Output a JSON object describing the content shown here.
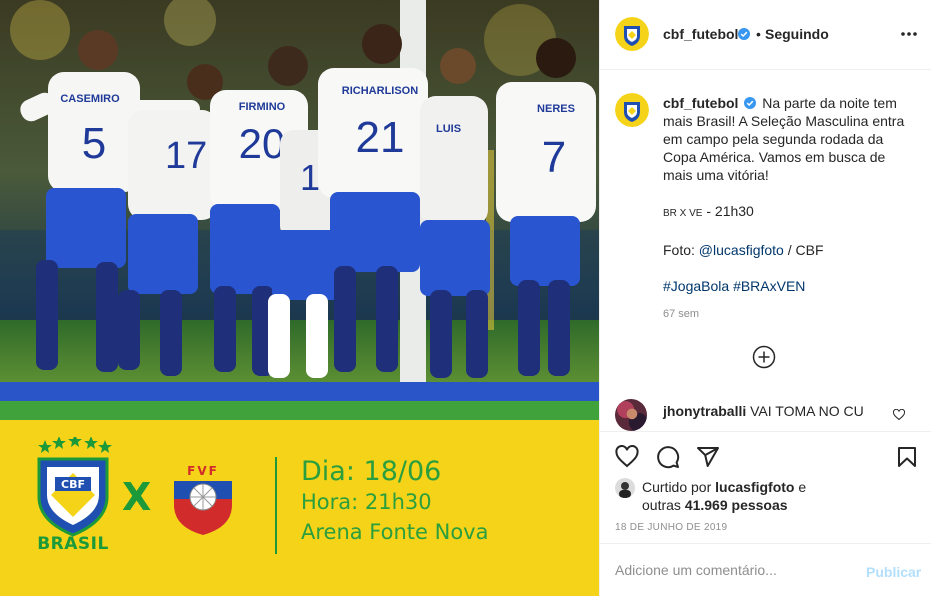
{
  "post": {
    "username": "cbf_futebol",
    "follow_status": "Seguindo",
    "separator": "•",
    "caption": {
      "line1": "Na parte da noite tem mais Brasil! A Seleção Masculina entra em campo pela segunda rodada da Copa América. Vamos em busca de mais uma vitória!",
      "match_prefix": "BR X VE",
      "match_time": " - 21h30",
      "photo_label": "Foto: ",
      "photo_credit": "@lucasfigfoto",
      "photo_source": " / CBF",
      "hashtag1": "#JogaBola",
      "hashtag2": "#BRAxVEN"
    },
    "time_ago": "67 sem",
    "date": "18 DE JUNHO DE 2019"
  },
  "comment": {
    "username": "jhonytraballi",
    "text": "VAI TOMA NO CU"
  },
  "likes": {
    "prefix": "Curtido por ",
    "user": "lucasfigfoto",
    "suffix": " e",
    "others_prefix": "outras ",
    "others_count": "41.969 pessoas"
  },
  "add_comment": {
    "placeholder": "Adicione um comentário...",
    "publish_label": "Publicar"
  },
  "graphic": {
    "brasil_label": "BRASIL",
    "vs_label": "X",
    "dia": "Dia: 18/06",
    "hora": "Hora: 21h30",
    "arena": "Arena Fonte Nova",
    "cbf_crest_text": "CBF",
    "fvf_crest_text": "FVF",
    "jerseys": [
      {
        "name": "CASEMIRO",
        "number": "5"
      },
      {
        "name": "FIRMINO",
        "number": "20"
      },
      {
        "name": "RICHARLISON",
        "number": "21"
      },
      {
        "name": "NERES",
        "number": "7"
      }
    ]
  },
  "colors": {
    "verified_blue": "#3897f0",
    "link_blue": "#00376b",
    "muted": "#8e8e8e",
    "publish_disabled": "#b2dffc",
    "brasil_green": "#1c9a3a",
    "brasil_yellow": "#f5d319",
    "brasil_blue": "#2a55c9"
  },
  "icons": [
    "verified-badge-icon",
    "more-options-icon",
    "load-more-plus-icon",
    "heart-icon",
    "comment-bubble-icon",
    "share-plane-icon",
    "bookmark-icon",
    "small-heart-icon"
  ]
}
